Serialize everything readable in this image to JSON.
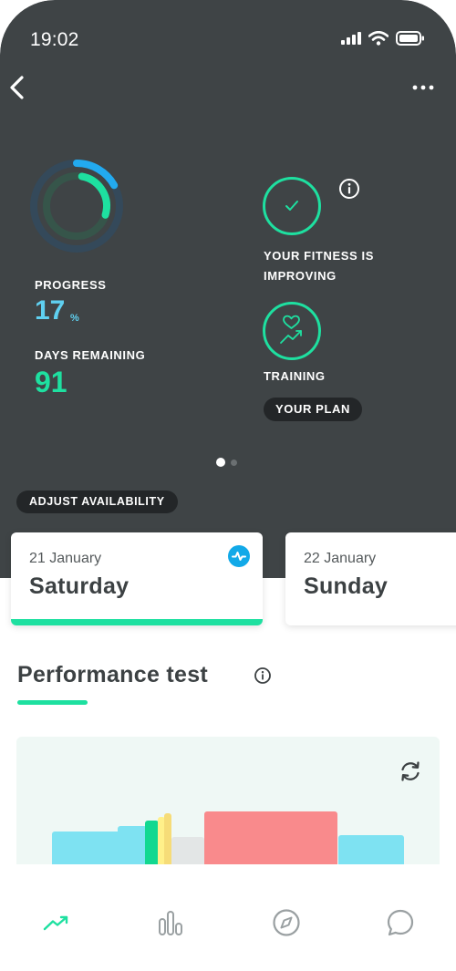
{
  "status_bar": {
    "time": "19:02"
  },
  "hero": {
    "progress": {
      "label": "PROGRESS",
      "value": "17",
      "unit": "%"
    },
    "days_remaining": {
      "label": "DAYS REMAINING",
      "value": "91"
    },
    "fitness": {
      "text": "YOUR FITNESS IS IMPROVING"
    },
    "training": {
      "label": "TRAINING",
      "plan_button": "YOUR PLAN"
    },
    "pager": {
      "active": 0,
      "count": 2
    },
    "adjust_button": "ADJUST AVAILABILITY"
  },
  "days": [
    {
      "date": "21 January",
      "name": "Saturday",
      "selected": true
    },
    {
      "date": "22 January",
      "name": "Sunday",
      "selected": false
    }
  ],
  "section": {
    "title": "Performance test"
  },
  "colors": {
    "background": "#3f4446",
    "accent_green": "#1ee0a0",
    "accent_blue": "#5fd0f0",
    "badge_blue": "#12a9e8",
    "chart_bg": "#eff8f5"
  },
  "tab_bar": [
    {
      "icon": "trend-up-icon",
      "active": true
    },
    {
      "icon": "stats-bars-icon",
      "active": false
    },
    {
      "icon": "compass-icon",
      "active": false
    },
    {
      "icon": "chat-bubble-icon",
      "active": false
    }
  ]
}
